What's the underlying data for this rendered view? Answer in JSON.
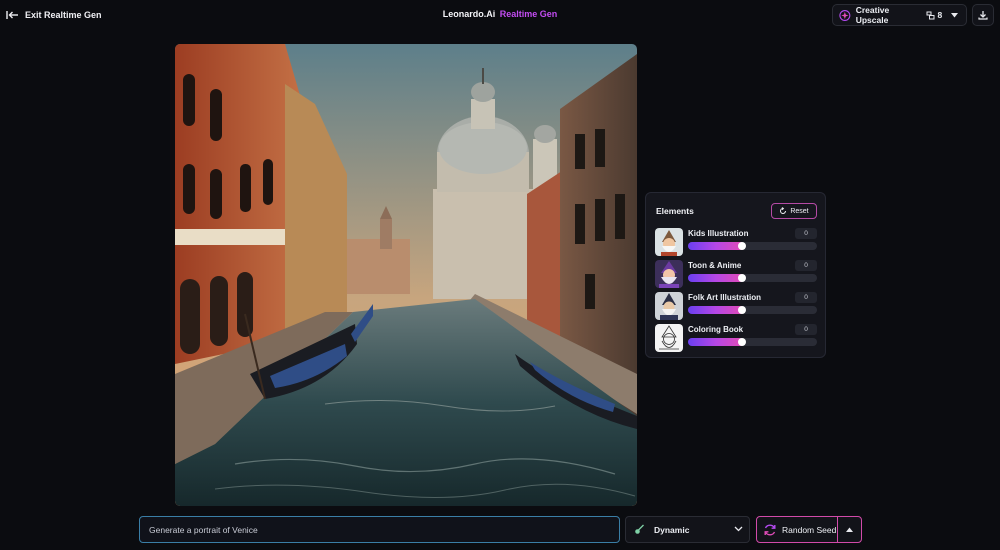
{
  "header": {
    "exit_label": "Exit Realtime Gen",
    "title_brand": "Leonardo.Ai",
    "title_accent": "Realtime Gen",
    "upscale_label": "Creative Upscale",
    "upscale_count": "8",
    "accent_color": "#c34cf2"
  },
  "canvas": {
    "image_subject": "Venice canal with gondolas and domed basilica at sunset"
  },
  "elements_panel": {
    "title": "Elements",
    "reset_label": "Reset",
    "items": [
      {
        "label": "Kids Illustration",
        "value": "0",
        "slider_fraction": 0.45
      },
      {
        "label": "Toon & Anime",
        "value": "0",
        "slider_fraction": 0.45
      },
      {
        "label": "Folk Art Illustration",
        "value": "0",
        "slider_fraction": 0.45
      },
      {
        "label": "Coloring Book",
        "value": "0",
        "slider_fraction": 0.45
      }
    ]
  },
  "bottom_bar": {
    "prompt_value": "Generate a portrait of Venice",
    "style_label": "Dynamic",
    "seed_label": "Random Seed"
  }
}
